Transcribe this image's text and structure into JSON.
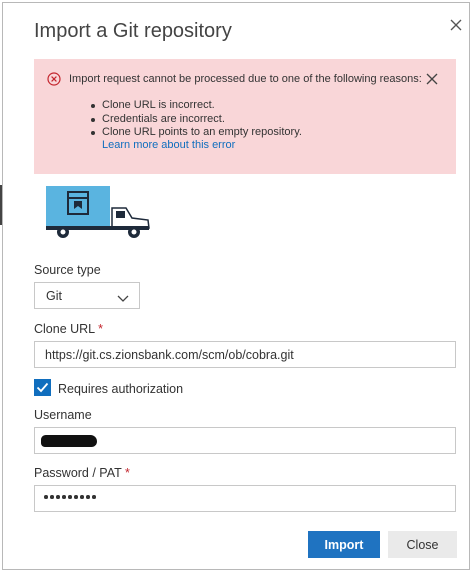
{
  "dialog": {
    "title": "Import a Git repository"
  },
  "error": {
    "heading": "Import request cannot be processed due to one of the following reasons:",
    "reasons": [
      "Clone URL is incorrect.",
      "Credentials are incorrect.",
      "Clone URL points to an empty repository."
    ],
    "link": "Learn more about this error"
  },
  "source_type": {
    "label": "Source type",
    "value": "Git"
  },
  "clone_url": {
    "label": "Clone URL",
    "required_mark": "*",
    "value": "https://git.cs.zionsbank.com/scm/ob/cobra.git"
  },
  "auth": {
    "label": "Requires authorization",
    "checked": true
  },
  "username": {
    "label": "Username"
  },
  "password": {
    "label": "Password / PAT",
    "required_mark": "*",
    "dot_count": 9
  },
  "buttons": {
    "import": "Import",
    "close": "Close"
  },
  "colors": {
    "accent": "#1f73c1",
    "error_bg": "#f9d6d8",
    "error_icon": "#c4262e",
    "link": "#106ebe",
    "truck_box": "#5ab4e0"
  }
}
